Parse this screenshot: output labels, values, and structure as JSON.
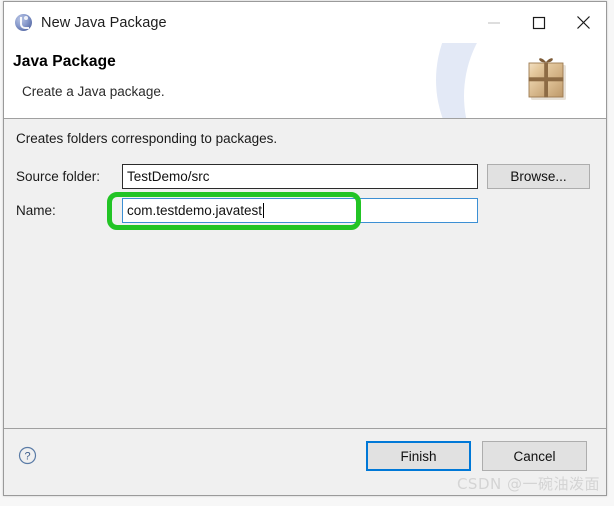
{
  "window": {
    "title": "New Java Package",
    "icon": "java-package-icon",
    "controls": {
      "minimize": "minimize-icon",
      "maximize": "maximize-icon",
      "close": "close-icon"
    }
  },
  "header": {
    "title": "Java Package",
    "subtitle": "Create a Java package.",
    "banner_icon": "package-box-icon"
  },
  "body": {
    "note": "Creates folders corresponding to packages.",
    "fields": {
      "source_folder": {
        "label": "Source folder:",
        "value": "TestDemo/src",
        "placeholder": ""
      },
      "name": {
        "label": "Name:",
        "value": "com.testdemo.javatest",
        "placeholder": ""
      }
    },
    "browse_label": "Browse...",
    "annotation_color": "#22c425"
  },
  "footer": {
    "help_icon": "help-circle-icon",
    "finish_label": "Finish",
    "cancel_label": "Cancel",
    "focus_color": "#0078d7"
  },
  "watermark": {
    "text": "CSDN @一碗油泼面"
  }
}
